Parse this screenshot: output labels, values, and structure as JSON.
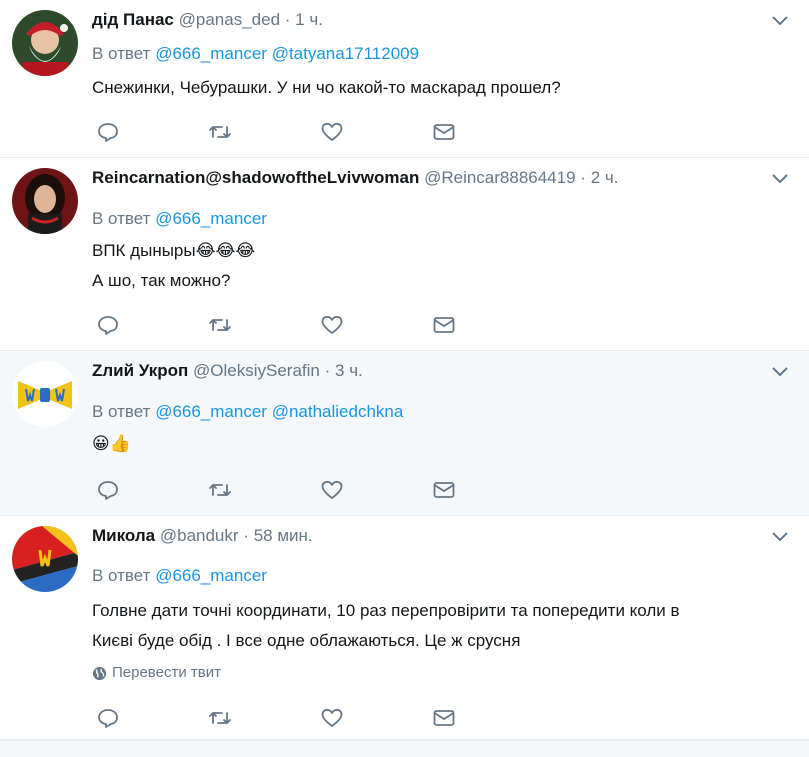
{
  "tweets": [
    {
      "name": "дід Панас",
      "handle": "@panas_ded",
      "time": "1 ч.",
      "reply_prefix": "В ответ",
      "mentions": [
        "@666_mancer",
        "@tatyana17112009"
      ],
      "lines": [
        "Снежинки, Чебурашки. У ни чо какой-то маскарад прошел?"
      ]
    },
    {
      "name": "Reincarnation@shadowoftheLvivwoman",
      "handle": "@Reincar88864419",
      "time": "2 ч.",
      "reply_prefix": "В ответ",
      "mentions": [
        "@666_mancer"
      ],
      "lines": [
        "ВПК дыныры😂😂😂",
        "А шо, так можно?"
      ]
    },
    {
      "name": "Zлий Укроп",
      "handle": "@OleksiySerafin",
      "time": "3 ч.",
      "reply_prefix": "В ответ",
      "mentions": [
        "@666_mancer",
        "@nathaliedchkna"
      ],
      "lines": [
        "😀👍"
      ]
    },
    {
      "name": "Микола",
      "handle": "@bandukr",
      "time": "58 мин.",
      "reply_prefix": "В ответ",
      "mentions": [
        "@666_mancer"
      ],
      "lines": [
        "Голвне дати точні координати, 10 раз перепровірити та попередити коли в",
        "Києві буде обід . І все одне облажаються. Це ж срусня"
      ],
      "translate": "Перевести твит"
    }
  ],
  "separator": "·",
  "icons": [
    "reply-icon",
    "retweet-icon",
    "like-icon",
    "direct-message-icon",
    "chevron-down-icon",
    "globe-icon"
  ],
  "colors": {
    "link": "#1b95e0",
    "muted": "#657786",
    "highlight_bg": "#f5f8fa",
    "border": "#e6ecf0"
  }
}
